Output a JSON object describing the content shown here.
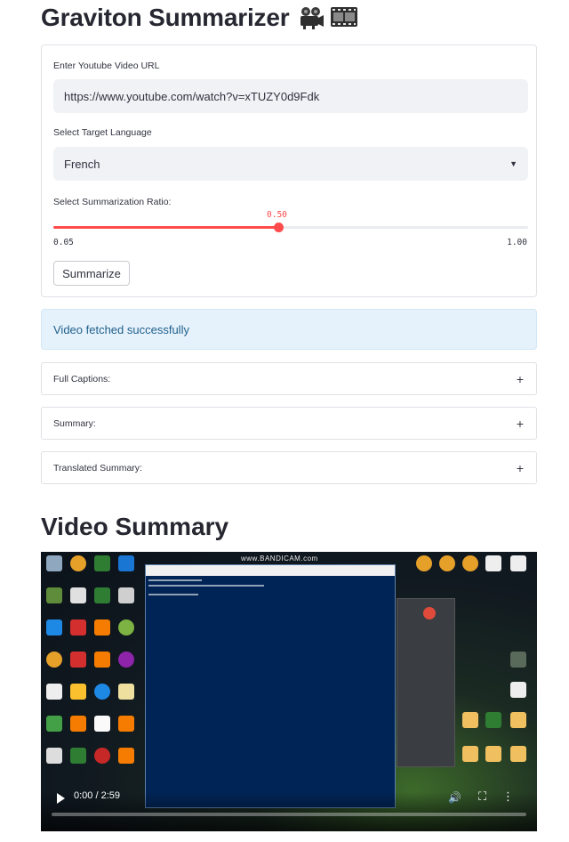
{
  "page": {
    "title": "Graviton Summarizer",
    "title_icons": [
      "movie-camera-icon",
      "film-frames-icon"
    ]
  },
  "form": {
    "url_label": "Enter Youtube Video URL",
    "url_value": "https://www.youtube.com/watch?v=xTUZY0d9Fdk",
    "language_label": "Select Target Language",
    "language_value": "French",
    "ratio_label": "Select Summarization Ratio:",
    "ratio_value": 0.5,
    "ratio_value_label": "0.50",
    "ratio_min": 0.05,
    "ratio_min_label": "0.05",
    "ratio_max": 1.0,
    "ratio_max_label": "1.00",
    "submit_label": "Summarize"
  },
  "status": {
    "message": "Video fetched successfully"
  },
  "expanders": [
    {
      "label": "Full Captions:",
      "icon": "plus-icon"
    },
    {
      "label": "Summary:",
      "icon": "plus-icon"
    },
    {
      "label": "Translated Summary:",
      "icon": "plus-icon"
    }
  ],
  "video": {
    "heading": "Video Summary",
    "time": "0:00 / 2:59",
    "progress": 0.0,
    "watermark": "www.BANDICAM.com"
  },
  "colors": {
    "accent": "#ff4b4b",
    "text": "#262730",
    "input_bg": "#f0f2f6",
    "info_bg": "#e6f2fb",
    "info_text": "#1f5f8b"
  }
}
